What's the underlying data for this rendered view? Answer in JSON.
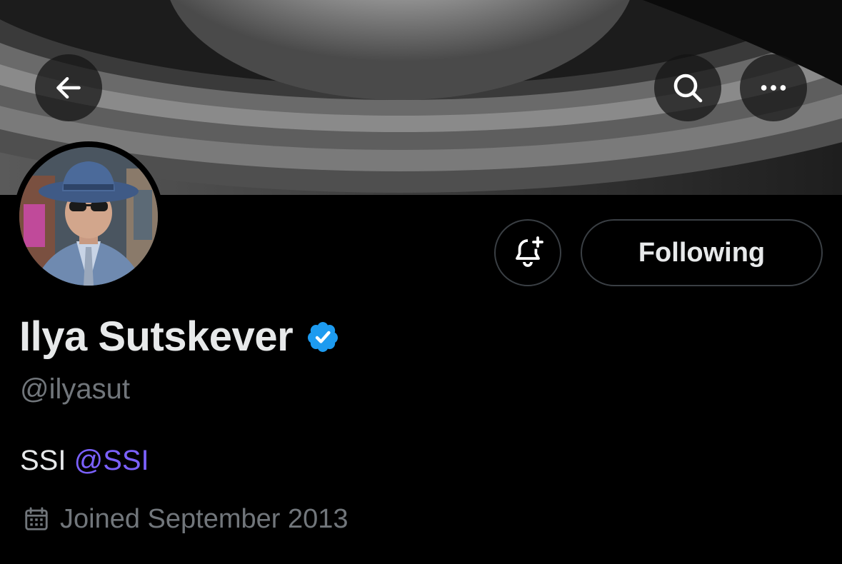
{
  "header": {
    "back_icon": "arrow-left-icon",
    "search_icon": "search-icon",
    "more_icon": "more-horizontal-icon"
  },
  "profile": {
    "display_name": "Ilya Sutskever",
    "verified": true,
    "verified_color": "#1d9bf0",
    "handle": "@ilyasut",
    "bio_text": "SSI ",
    "bio_mention": "@SSI",
    "mention_color": "#7b61ff",
    "joined": "Joined September 2013",
    "joined_icon": "calendar-icon"
  },
  "actions": {
    "notify_icon": "bell-plus-icon",
    "following_label": "Following"
  }
}
